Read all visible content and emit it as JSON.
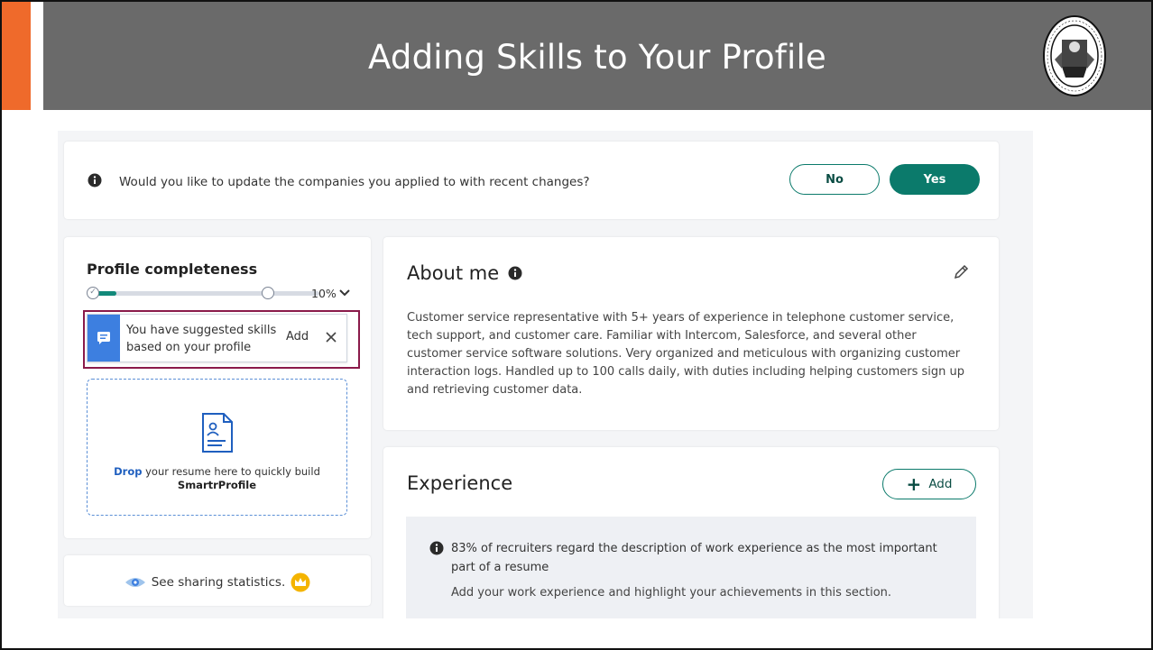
{
  "slide": {
    "title": "Adding Skills to Your Profile",
    "seal_text": "SEAL OF THE CITY AND COUNTY OF SAN FRANCISCO",
    "colors": {
      "accent": "#ef6a2b",
      "title_bar": "#6a6a6a",
      "primary": "#0b7a6b",
      "highlight_outline": "#8a1a4a"
    }
  },
  "notice": {
    "icon": "info-icon",
    "text": "Would you like to update the companies you applied to with recent changes?",
    "no_label": "No",
    "yes_label": "Yes"
  },
  "profile": {
    "title": "Profile completeness",
    "progress_value": 0.1,
    "progress_label": "10%",
    "suggestion": {
      "icon": "chat-bubble-icon",
      "text": "You have suggested skills based on your profile",
      "add_label": "Add"
    },
    "dropzone": {
      "icon": "resume-document-icon",
      "lead": "Drop",
      "text": " your resume here to quickly build",
      "product": "SmartrProfile"
    }
  },
  "sharing": {
    "label": "See sharing statistics.",
    "icons": [
      "eye-icon",
      "crown-icon"
    ]
  },
  "about": {
    "title": "About me",
    "text": "Customer service representative with 5+ years of experience in telephone customer service, tech support, and customer care. Familiar with Intercom, Salesforce, and several other customer service software solutions. Very organized and meticulous with organizing customer interaction logs. Handled up to 100 calls daily, with duties including helping customers sign up and retrieving customer data."
  },
  "experience": {
    "title": "Experience",
    "add_label": "Add",
    "tip_head": "83% of recruiters regard the description of work experience as the most important part of a resume",
    "tip_body": "Add your work experience and highlight your achievements in this section."
  }
}
